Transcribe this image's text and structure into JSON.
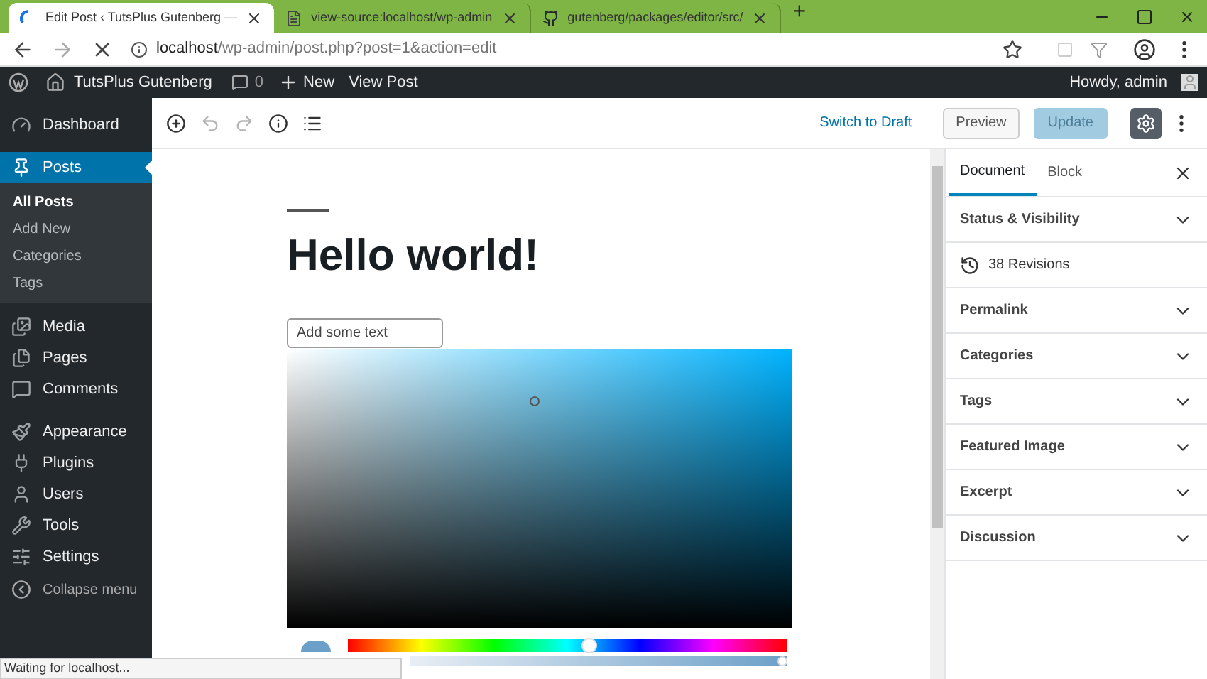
{
  "browser": {
    "tabs": [
      {
        "title": "Edit Post ‹ TutsPlus Gutenberg —",
        "kind": "wp",
        "selected": true
      },
      {
        "title": "view-source:localhost/wp-admin",
        "kind": "page",
        "selected": false
      },
      {
        "title": "gutenberg/packages/editor/src/",
        "kind": "github",
        "selected": false
      }
    ],
    "new_tab": "+",
    "url_host": "localhost",
    "url_path": "/wp-admin/post.php?post=1&action=edit"
  },
  "admin_bar": {
    "site_name": "TutsPlus Gutenberg",
    "comments": "0",
    "new": "New",
    "view_post": "View Post",
    "greeting": "Howdy, admin"
  },
  "sidebar": {
    "items": [
      {
        "label": "Dashboard",
        "kind": "dashboard",
        "selected": false
      },
      {
        "label": "Posts",
        "kind": "posts",
        "selected": true,
        "children": [
          {
            "label": "All Posts",
            "selected": true
          },
          {
            "label": "Add New",
            "selected": false
          },
          {
            "label": "Categories",
            "selected": false
          },
          {
            "label": "Tags",
            "selected": false
          }
        ]
      },
      {
        "label": "Media",
        "kind": "media",
        "selected": false
      },
      {
        "label": "Pages",
        "kind": "pages",
        "selected": false
      },
      {
        "label": "Comments",
        "kind": "comments",
        "selected": false
      },
      {
        "label": "Appearance",
        "kind": "appearance",
        "selected": false
      },
      {
        "label": "Plugins",
        "kind": "plugins",
        "selected": false
      },
      {
        "label": "Users",
        "kind": "users",
        "selected": false
      },
      {
        "label": "Tools",
        "kind": "tools",
        "selected": false
      },
      {
        "label": "Settings",
        "kind": "settings",
        "selected": false
      }
    ],
    "collapse": "Collapse menu"
  },
  "toolbar": {
    "tools": [
      {
        "kind": "add",
        "disabled": false
      },
      {
        "kind": "undo",
        "disabled": true
      },
      {
        "kind": "redo",
        "disabled": true
      },
      {
        "kind": "info",
        "disabled": false
      },
      {
        "kind": "outline",
        "disabled": false
      }
    ],
    "switch_to_draft": "Switch to Draft",
    "preview": "Preview",
    "update": {
      "label": "Update",
      "disabled": true
    },
    "settings_selected": true
  },
  "editor": {
    "title": "Hello world!",
    "input": {
      "placeholder": "Add some text"
    },
    "color_picker": {
      "hue": {
        "level": 0.55
      },
      "alpha": {
        "level": 0.99
      }
    }
  },
  "panel": {
    "tabs": [
      {
        "label": "Document",
        "selected": true
      },
      {
        "label": "Block",
        "selected": false
      }
    ],
    "sections": [
      {
        "label": "Status & Visibility",
        "kind": "section"
      },
      {
        "label": "38 Revisions",
        "kind": "revisions"
      },
      {
        "label": "Permalink",
        "kind": "section"
      },
      {
        "label": "Categories",
        "kind": "section"
      },
      {
        "label": "Tags",
        "kind": "section"
      },
      {
        "label": "Featured Image",
        "kind": "section"
      },
      {
        "label": "Excerpt",
        "kind": "section"
      },
      {
        "label": "Discussion",
        "kind": "section"
      }
    ]
  },
  "status_bar": "Waiting for localhost..."
}
